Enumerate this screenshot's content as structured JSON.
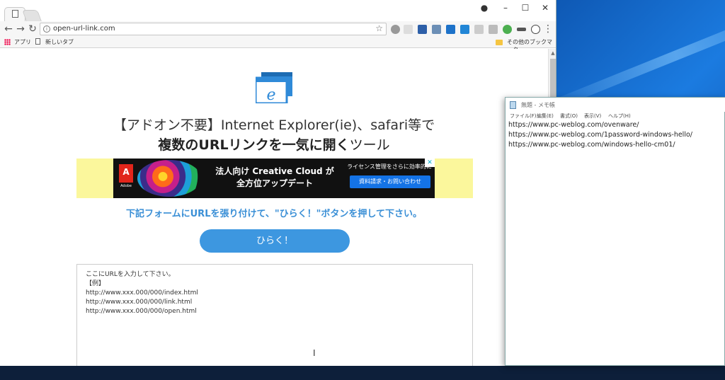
{
  "browser": {
    "tab_icon": "document-icon",
    "url": "open-url-link.com",
    "bookmarks": {
      "apps": "アプリ",
      "new_tab": "新しいタブ",
      "other": "その他のブックマーク"
    },
    "window_controls": {
      "minimize": "–",
      "maximize": "☐",
      "close": "✕"
    }
  },
  "page": {
    "title_line1": "【アドオン不要】Internet Explorer(ie)、safari等で",
    "title_line2_bold_a": "複数の",
    "title_line2_bold_b": "URLリンクを一気に開く",
    "title_line2_rest": "ツール",
    "ad": {
      "brand": "A",
      "brand_text": "Adobe",
      "headline_1": "法人向け Creative Cloud が",
      "headline_2": "全方位アップデート",
      "subtext": "ライセンス管理をさらに効率的に",
      "cta": "資料請求・お問い合わせ"
    },
    "instruction": "下記フォームにURLを張り付けて、\"ひらく！\"ボタンを押して下さい。",
    "open_button": "ひらく！",
    "textarea_lines": [
      "ここにURLを入力して下さい。",
      "【例】",
      "http://www.xxx.000/000/index.html",
      "http://www.xxx.000/000/link.html",
      "http://www.xxx.000/000/open.html"
    ]
  },
  "notepad": {
    "title": "無題 - メモ帳",
    "menu": [
      "ファイル(F)",
      "編集(E)",
      "書式(O)",
      "表示(V)",
      "ヘルプ(H)"
    ],
    "lines": [
      "https://www.pc-weblog.com/ovenware/",
      "https://www.pc-weblog.com/1password-windows-hello/",
      "https://www.pc-weblog.com/windows-hello-cm01/"
    ]
  }
}
